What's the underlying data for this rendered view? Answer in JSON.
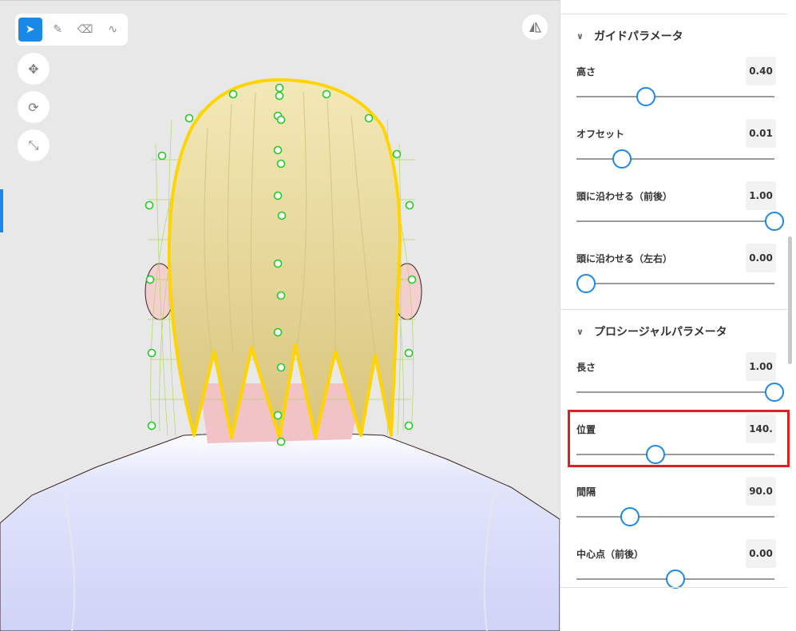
{
  "panel": {
    "sections": [
      {
        "title": "ガイドパラメータ",
        "params": [
          {
            "label": "高さ",
            "value": "0.40",
            "position": 0.35
          },
          {
            "label": "オフセット",
            "value": "0.01",
            "position": 0.23
          },
          {
            "label": "頭に沿わせる（前後）",
            "value": "1.00",
            "position": 1.0
          },
          {
            "label": "頭に沿わせる（左右）",
            "value": "0.00",
            "position": 0.05
          }
        ]
      },
      {
        "title": "プロシージャルパラメータ",
        "params": [
          {
            "label": "長さ",
            "value": "1.00",
            "position": 1.0
          },
          {
            "label": "位置",
            "value": "140.",
            "position": 0.4
          },
          {
            "label": "間隔",
            "value": "90.0",
            "position": 0.27
          },
          {
            "label": "中心点（前後）",
            "value": "0.00",
            "position": 0.5
          }
        ]
      }
    ]
  },
  "toolbar": {
    "tools": [
      {
        "icon": "cursor-icon",
        "glyph": "➤",
        "active": true
      },
      {
        "icon": "pencil-icon",
        "glyph": "✎",
        "active": false
      },
      {
        "icon": "eraser-icon",
        "glyph": "⌫",
        "active": false
      },
      {
        "icon": "path-node-icon",
        "glyph": "∿",
        "active": false
      }
    ]
  },
  "colors": {
    "accent": "#1a88e6",
    "highlight": "#e02020",
    "hair": "#eadba0",
    "hair_outline": "#ffd400",
    "guide_points": "#22cc22",
    "shirt": "#d0d4f8"
  }
}
